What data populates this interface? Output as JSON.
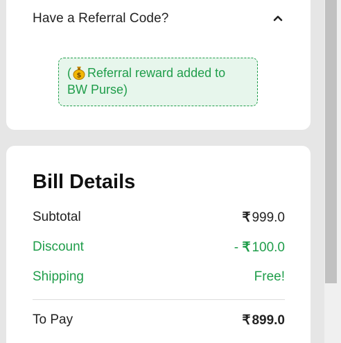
{
  "referral": {
    "title": "Have a Referral Code?",
    "chevron_icon": "chevron-up-icon",
    "reward_prefix": "(",
    "reward_icon": "money-bag-icon",
    "reward_text": "Referral reward added to BW Purse)"
  },
  "bill": {
    "title": "Bill Details",
    "currency_symbol": "₹",
    "subtotal": {
      "label": "Subtotal",
      "amount": "999.0"
    },
    "discount": {
      "label": "Discount",
      "prefix": "-",
      "amount": "100.0"
    },
    "shipping": {
      "label": "Shipping",
      "value": "Free!"
    },
    "to_pay": {
      "label": "To Pay",
      "amount": "899.0"
    }
  },
  "colors": {
    "accent_green": "#1f9d4a",
    "note_background": "#e7f6ec",
    "page_background": "#e6e6e6"
  }
}
